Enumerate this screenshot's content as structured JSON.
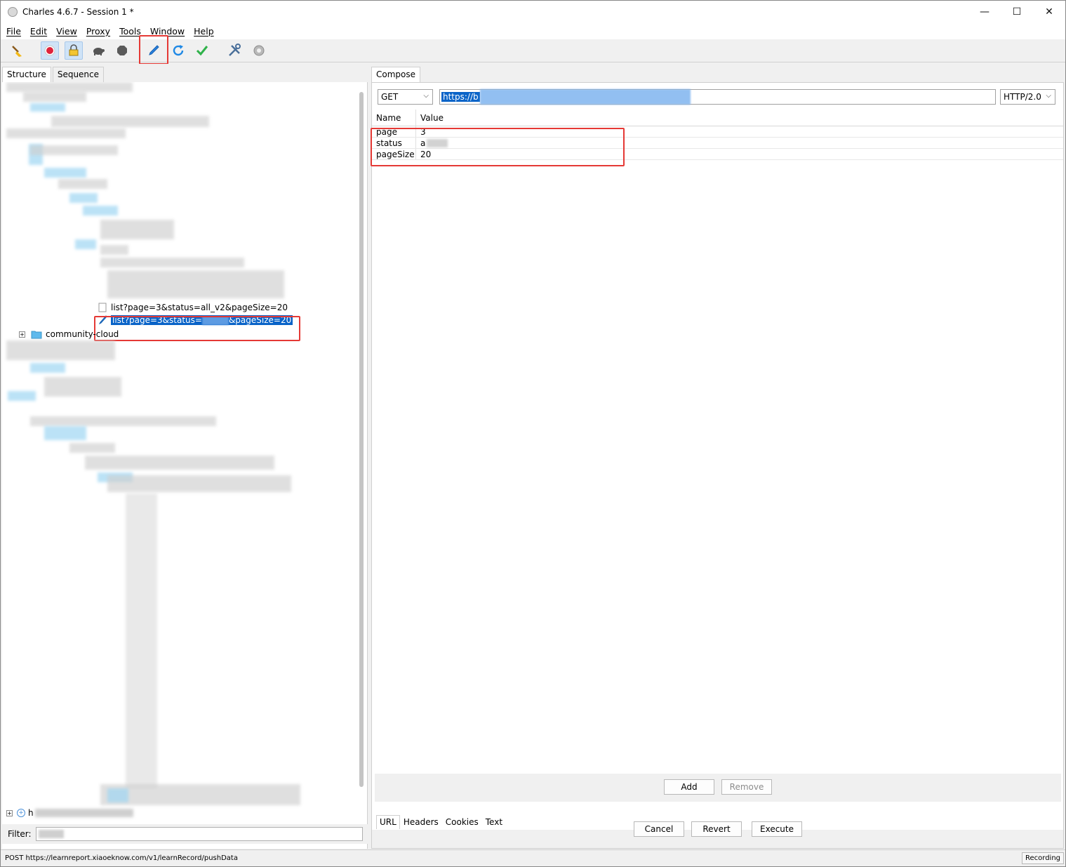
{
  "window": {
    "title": "Charles 4.6.7 - Session 1 *",
    "minimize_glyph": "—",
    "maximize_glyph": "☐",
    "close_glyph": "✕"
  },
  "menu": [
    "File",
    "Edit",
    "View",
    "Proxy",
    "Tools",
    "Window",
    "Help"
  ],
  "toolbar": {
    "icons": [
      "broom-icon",
      "record-icon",
      "ssl-proxy-lock-icon",
      "throttle-turtle-icon",
      "breakpoints-stop-icon",
      "compose-pen-icon",
      "repeat-refresh-icon",
      "validate-check-icon",
      "tools-wrench-icon",
      "settings-gear-icon"
    ]
  },
  "left_panel": {
    "tabs": [
      "Structure",
      "Sequence"
    ],
    "tree_nodes": {
      "request_prev": "list?page=3&status=all_v2&pageSize=20",
      "request_selected_prefix": "list?page=3&status=",
      "request_selected_suffix": "&pageSize=20",
      "folder_label": "community-cloud",
      "bottom_node_prefix": "h"
    },
    "filter_label": "Filter:"
  },
  "right_panel": {
    "tabs": [
      "Compose"
    ],
    "method": "GET",
    "url_prefix": "https://b",
    "protocol": "HTTP/2.0",
    "params_headers": {
      "name": "Name",
      "value": "Value"
    },
    "params": [
      {
        "name": "page",
        "value": "3"
      },
      {
        "name": "status",
        "value": "a"
      },
      {
        "name": "pageSize",
        "value": "20"
      }
    ],
    "add_button": "Add",
    "remove_button": "Remove",
    "subtabs": [
      "URL",
      "Headers",
      "Cookies",
      "Text"
    ],
    "cancel_button": "Cancel",
    "revert_button": "Revert",
    "execute_button": "Execute"
  },
  "status_bar": {
    "message": "POST https://learnreport.xiaoeknow.com/v1/learnRecord/pushData",
    "recording": "Recording"
  },
  "colors": {
    "selection": "#0a64c8",
    "highlight_box": "#e53935",
    "record_red": "#e0233b",
    "refresh_blue": "#1e88e5",
    "check_green": "#2fb24a"
  }
}
